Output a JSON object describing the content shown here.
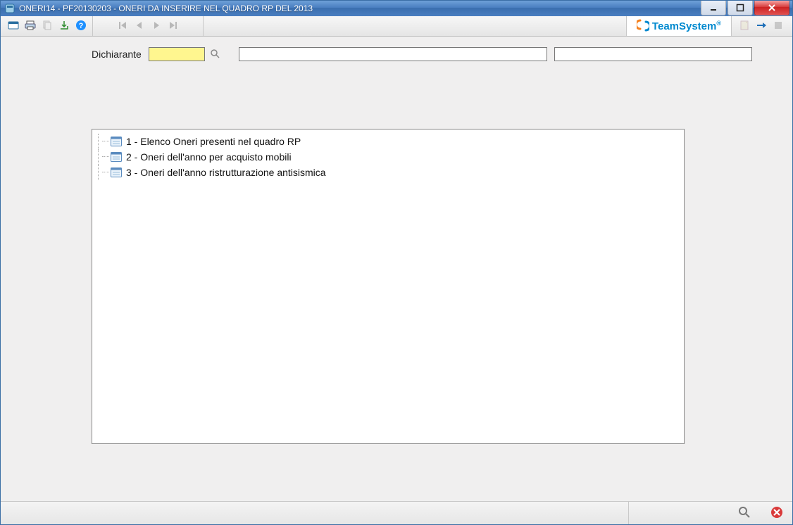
{
  "window": {
    "title": "ONERI14  - PF20130203 -  ONERI DA INSERIRE NEL QUADRO RP DEL 2013"
  },
  "brand": {
    "name": "TeamSystem",
    "reg": "®"
  },
  "form": {
    "dichiarante_label": "Dichiarante",
    "dichiarante_value": "",
    "desc1_value": "",
    "desc2_value": ""
  },
  "tree": {
    "items": [
      {
        "label": "1 - Elenco Oneri presenti nel quadro RP"
      },
      {
        "label": "2 - Oneri dell'anno per acquisto mobili"
      },
      {
        "label": "3 - Oneri dell'anno ristrutturazione antisismica"
      }
    ]
  }
}
